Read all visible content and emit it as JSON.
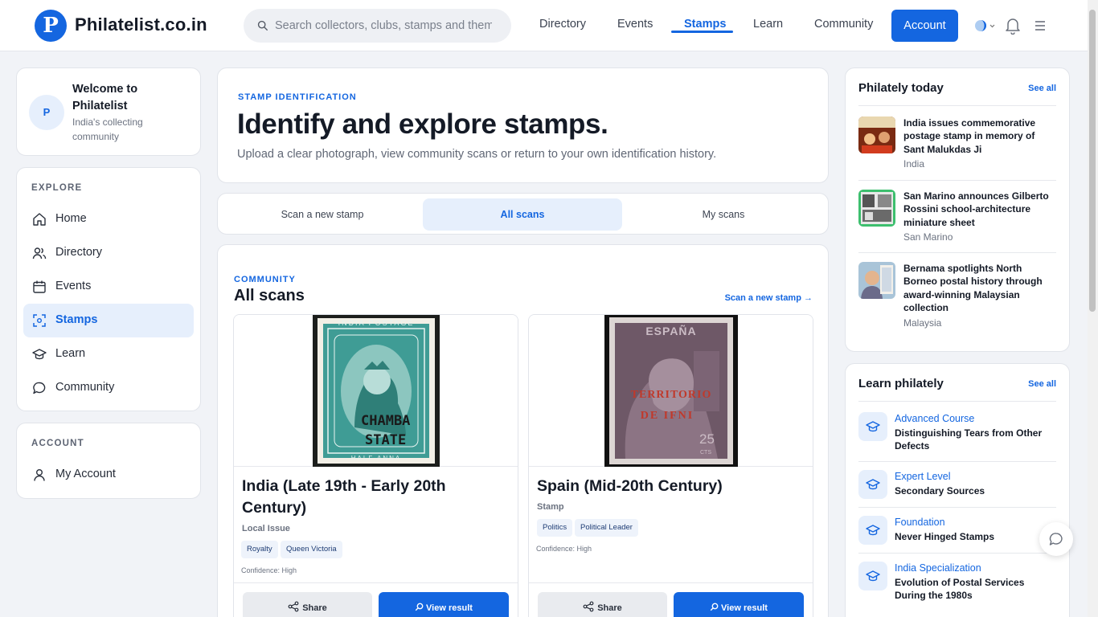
{
  "header": {
    "logo_letter": "P",
    "logo_text": "Philatelist.co.in",
    "search_placeholder": "Search collectors, clubs, stamps and themes",
    "nav": [
      "Directory",
      "Events",
      "Stamps",
      "Learn",
      "Community"
    ],
    "active_nav": "Stamps",
    "account_label": "Account",
    "icons": [
      "theme-toggle-icon",
      "bell-icon",
      "menu-icon"
    ]
  },
  "sidebar": {
    "welcome": {
      "avatar": "P",
      "title": "Welcome to Philatelist",
      "subtitle": "India's collecting community"
    },
    "explore_label": "EXPLORE",
    "items": [
      {
        "label": "Home",
        "icon": "home-icon"
      },
      {
        "label": "Directory",
        "icon": "users-icon"
      },
      {
        "label": "Events",
        "icon": "calendar-icon"
      },
      {
        "label": "Stamps",
        "icon": "scan-icon",
        "active": true
      },
      {
        "label": "Learn",
        "icon": "graduation-cap-icon"
      },
      {
        "label": "Community",
        "icon": "chat-icon"
      }
    ],
    "account_label": "ACCOUNT",
    "account_items": [
      {
        "label": "My Account",
        "icon": "user-icon"
      }
    ]
  },
  "hero": {
    "eyebrow": "STAMP IDENTIFICATION",
    "title": "Identify and explore stamps.",
    "subtitle": "Upload a clear photograph, view community scans or return to your own identification history."
  },
  "tabs": [
    {
      "label": "Scan a new stamp"
    },
    {
      "label": "All scans",
      "active": true
    },
    {
      "label": "My scans"
    }
  ],
  "scans": {
    "eyebrow": "COMMUNITY",
    "title": "All scans",
    "link": "Scan a new stamp →",
    "cards": [
      {
        "title": "India (Late 19th - Early 20th Century)",
        "type": "Local Issue",
        "tags": [
          "Royalty",
          "Queen Victoria"
        ],
        "confidence": "Confidence: High",
        "stamp_text": [
          "INDIA POSTAGE",
          "HALF ANNA",
          "CHAMBA",
          "STATE"
        ],
        "share": "Share",
        "view": "View result"
      },
      {
        "title": "Spain (Mid-20th Century)",
        "type": "Stamp",
        "tags": [
          "Politics",
          "Political Leader"
        ],
        "confidence": "Confidence: High",
        "stamp_text": [
          "ESPAÑA",
          "TERRITORIO",
          "DE IFNI",
          "25",
          "CTS"
        ],
        "share": "Share",
        "view": "View result"
      }
    ]
  },
  "today": {
    "title": "Philately today",
    "see_all": "See all",
    "items": [
      {
        "title": "India issues commemorative postage stamp in memory of Sant Malukdas Ji",
        "location": "India"
      },
      {
        "title": "San Marino announces Gilberto Rossini school-architecture miniature sheet",
        "location": "San Marino"
      },
      {
        "title": "Bernama spotlights North Borneo postal history through award-winning Malaysian collection",
        "location": "Malaysia"
      }
    ]
  },
  "learn": {
    "title": "Learn philately",
    "see_all": "See all",
    "items": [
      {
        "level": "Advanced Course",
        "title": "Distinguishing Tears from Other Defects"
      },
      {
        "level": "Expert Level",
        "title": "Secondary Sources"
      },
      {
        "level": "Foundation",
        "title": "Never Hinged Stamps"
      },
      {
        "level": "India Specialization",
        "title": "Evolution of Postal Services During the 1980s"
      }
    ]
  },
  "colors": {
    "accent": "#1466e0",
    "accent_light": "#e6effc",
    "background": "#f1f3f7",
    "stamp_india": "#3f9c95",
    "stamp_spain": "#6e5867"
  }
}
